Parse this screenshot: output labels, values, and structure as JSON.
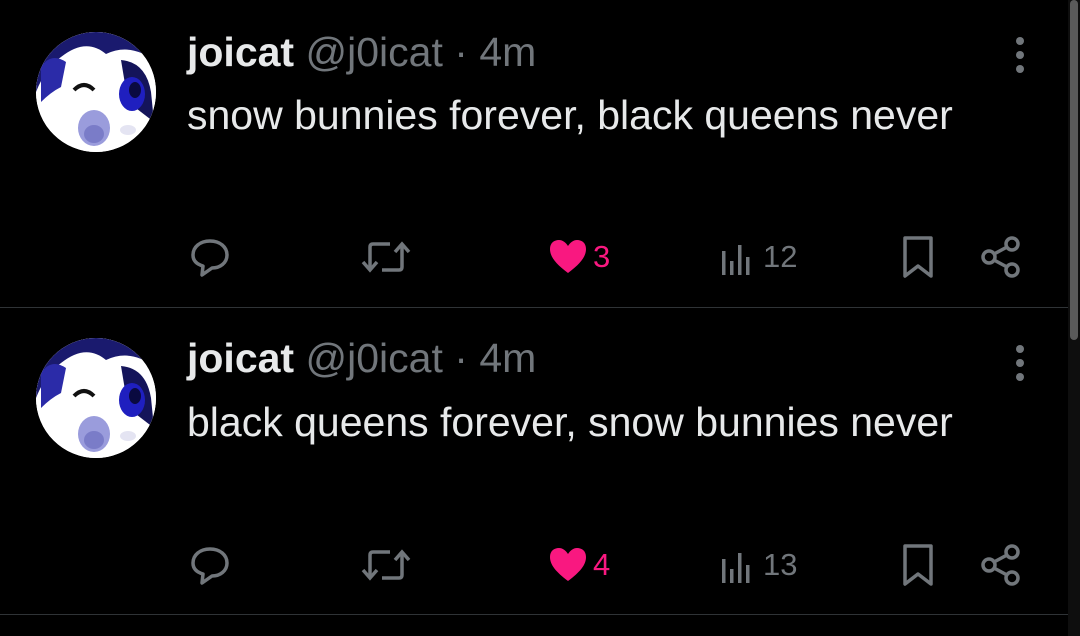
{
  "colors": {
    "background": "#000000",
    "text": "#e7e9ea",
    "secondary": "#71767b",
    "like": "#f91880",
    "divider": "#2f3336"
  },
  "tweets": [
    {
      "name": "joicat",
      "handle": "@j0icat",
      "separator": "·",
      "time": "4m",
      "text": "snow bunnies forever, black queens never",
      "likes": "3",
      "views": "12",
      "liked": true,
      "icons": [
        "reply-icon",
        "retweet-icon",
        "heart-icon",
        "views-icon",
        "bookmark-icon",
        "share-icon",
        "more-icon"
      ]
    },
    {
      "name": "joicat",
      "handle": "@j0icat",
      "separator": "·",
      "time": "4m",
      "text": "black queens forever, snow bunnies never",
      "likes": "4",
      "views": "13",
      "liked": true,
      "icons": [
        "reply-icon",
        "retweet-icon",
        "heart-icon",
        "views-icon",
        "bookmark-icon",
        "share-icon",
        "more-icon"
      ]
    }
  ]
}
